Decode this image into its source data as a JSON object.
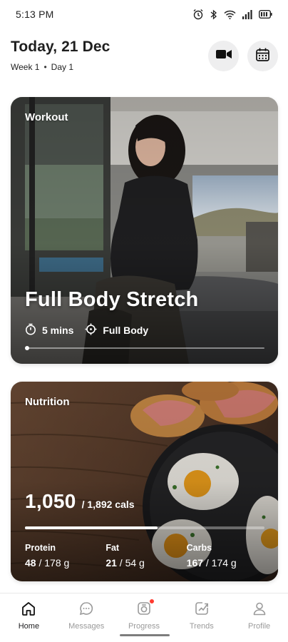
{
  "status_bar": {
    "time": "5:13 PM",
    "icons": [
      "alarm-icon",
      "bluetooth-icon",
      "wifi-icon",
      "signal-icon",
      "battery-icon"
    ]
  },
  "header": {
    "title": "Today, 21 Dec",
    "week": "Week 1",
    "separator": "•",
    "day": "Day 1",
    "actions": [
      "video-camera-icon",
      "calendar-icon"
    ]
  },
  "workout": {
    "label": "Workout",
    "title": "Full Body Stretch",
    "duration": "5 mins",
    "focus": "Full Body",
    "progress": 0.0
  },
  "nutrition": {
    "label": "Nutrition",
    "calories_consumed": "1,050",
    "calories_total": "/ 1,892 cals",
    "calories_progress": 0.555,
    "macros": [
      {
        "name": "Protein",
        "value": "48",
        "total": " / 178 g"
      },
      {
        "name": "Fat",
        "value": "21",
        "total": " / 54 g"
      },
      {
        "name": "Carbs",
        "value": "167",
        "total": " / 174 g"
      }
    ]
  },
  "nav": {
    "items": [
      {
        "label": "Home",
        "icon": "home-icon",
        "active": true
      },
      {
        "label": "Messages",
        "icon": "chat-bubble-icon",
        "active": false
      },
      {
        "label": "Progress",
        "icon": "progress-camera-icon",
        "active": false,
        "badge": true
      },
      {
        "label": "Trends",
        "icon": "trends-chart-icon",
        "active": false
      },
      {
        "label": "Profile",
        "icon": "profile-icon",
        "active": false
      }
    ]
  },
  "colors": {
    "badge": "#ff3b30",
    "button_bg": "#eeeeef",
    "inactive_nav": "#9a9a9a"
  }
}
